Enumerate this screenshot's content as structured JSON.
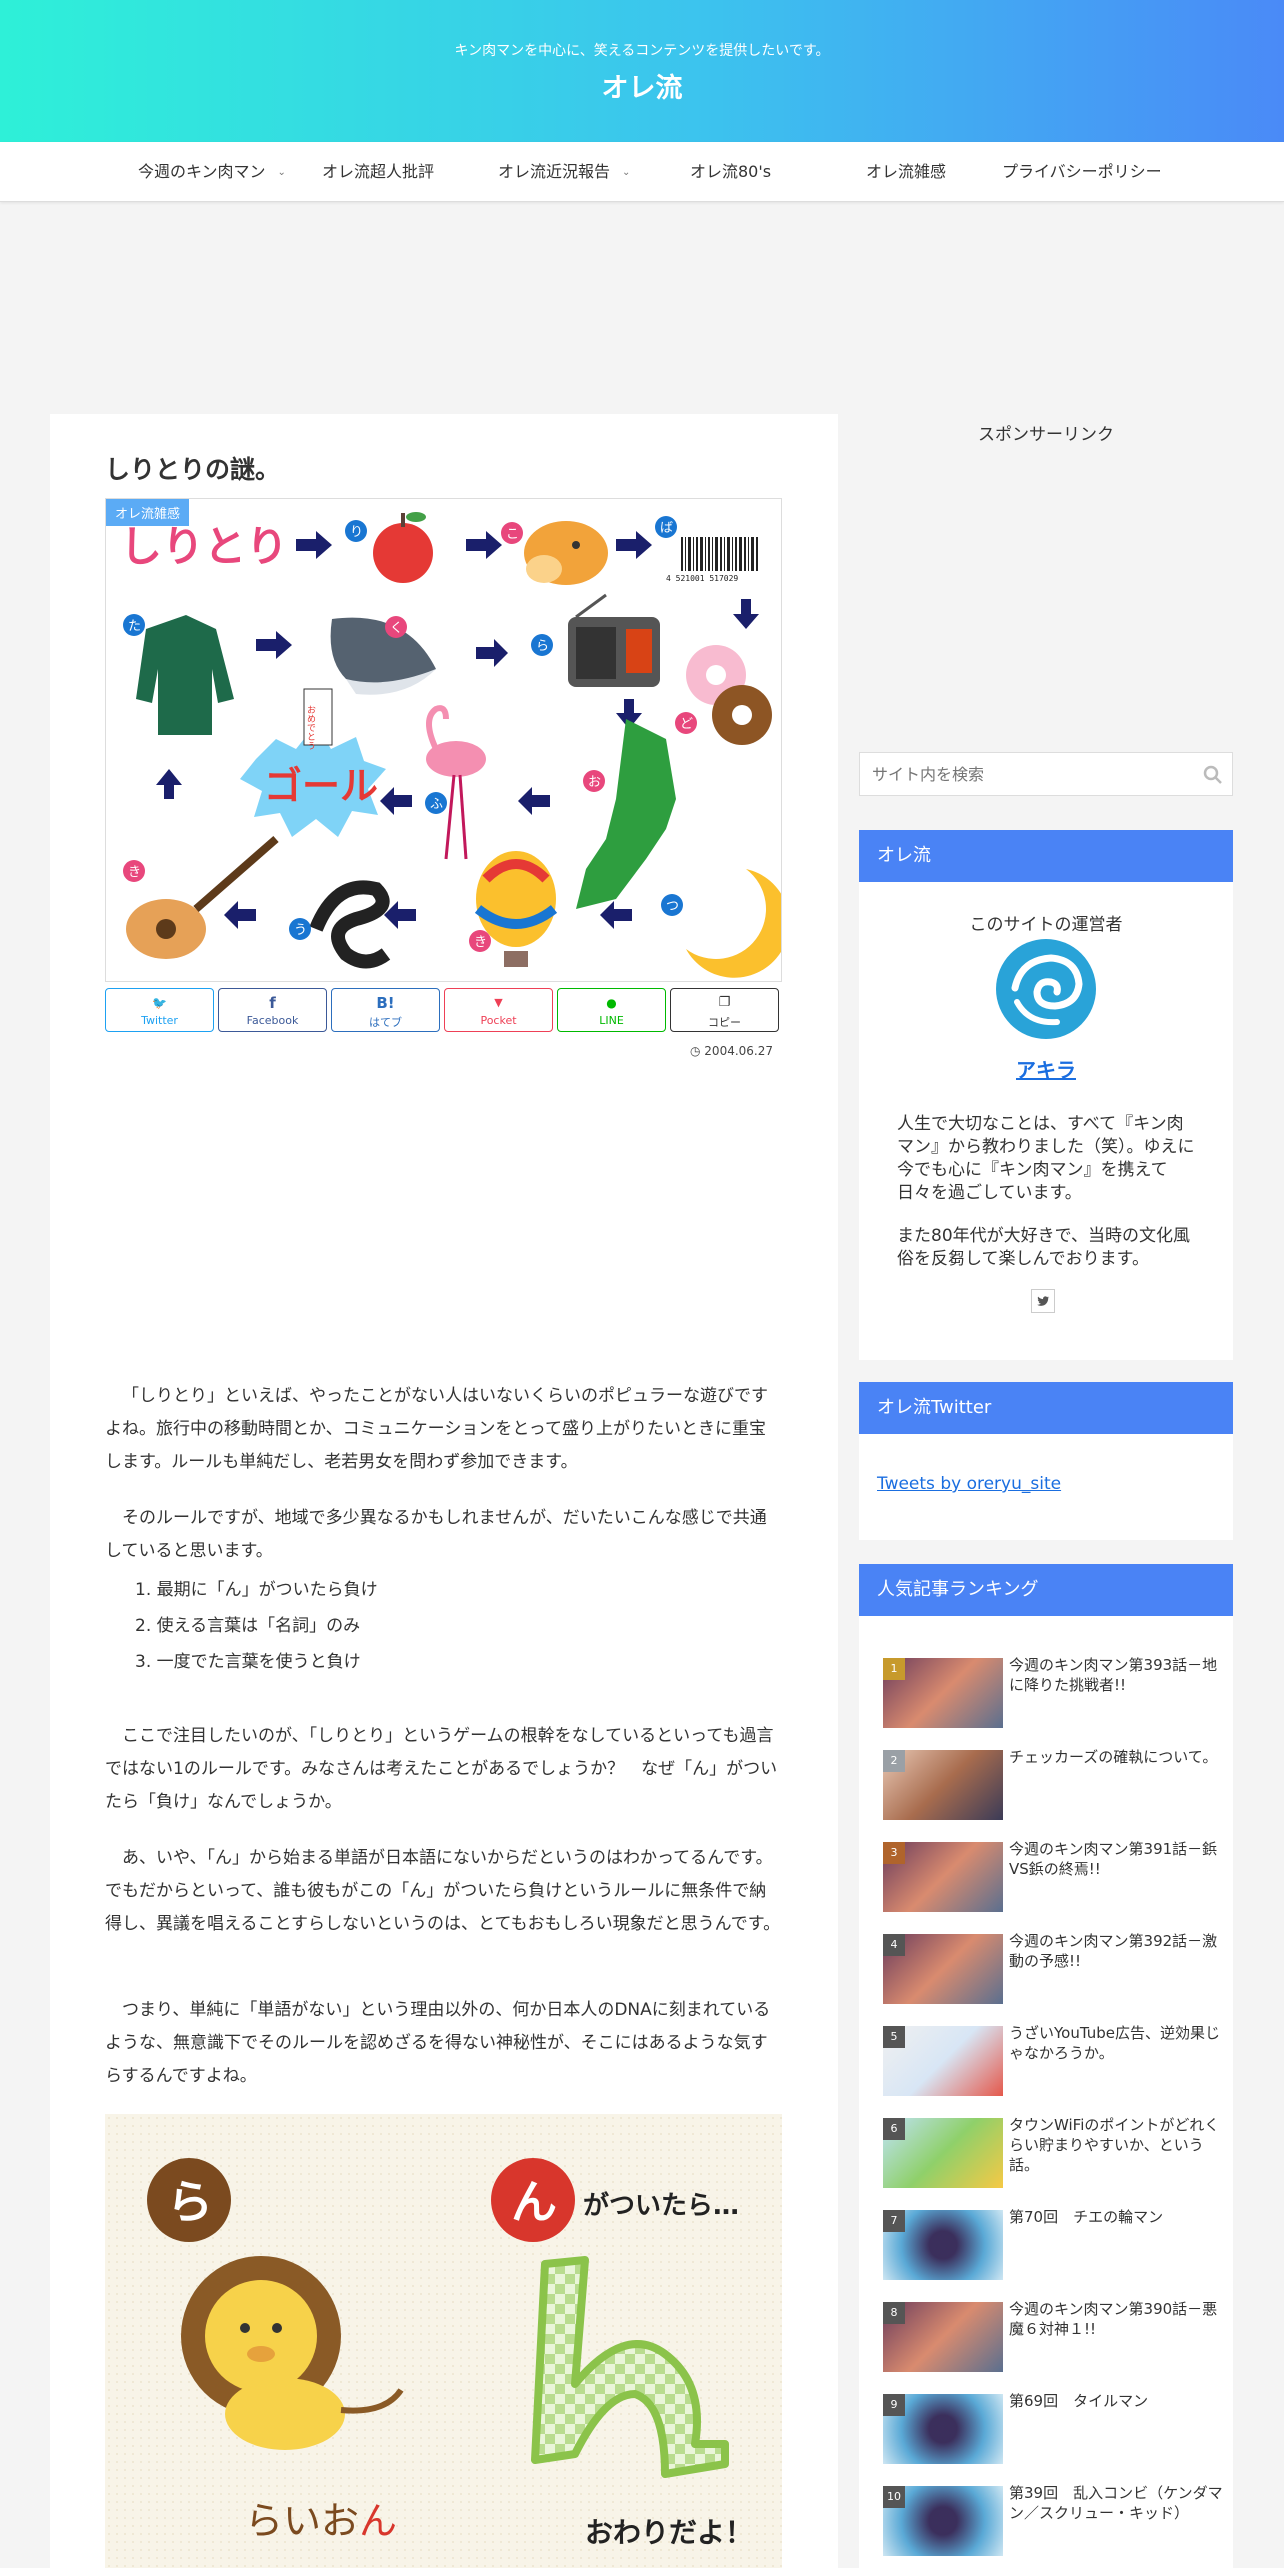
{
  "header": {
    "tagline": "キン肉マンを中心に、笑えるコンテンツを提供したいです。",
    "site_title": "オレ流"
  },
  "nav": {
    "items": [
      {
        "label": "今週のキン肉マン"
      },
      {
        "label": "オレ流超人批評"
      },
      {
        "label": "オレ流近況報告"
      },
      {
        "label": "オレ流80's"
      },
      {
        "label": "オレ流雑感"
      },
      {
        "label": "プライバシーポリシー"
      }
    ]
  },
  "article": {
    "title": "しりとりの謎。",
    "category": "オレ流雑感",
    "eyecatch_text": {
      "shiritori": "しりとり",
      "goal": "ゴール",
      "omedetou": "おめでとう",
      "barcode": "4 521001 517029"
    },
    "share": [
      {
        "icon": "🐦",
        "label": "Twitter"
      },
      {
        "icon": "f",
        "label": "Facebook"
      },
      {
        "icon": "B!",
        "label": "はてブ"
      },
      {
        "icon": "▼",
        "label": "Pocket"
      },
      {
        "icon": "●",
        "label": "LINE"
      },
      {
        "icon": "❐",
        "label": "コピー"
      }
    ],
    "date": "2004.06.27",
    "p1": "「しりとり」といえば、やったことがない人はいないくらいのポピュラーな遊びですよね。旅行中の移動時間とか、コミュニケーションをとって盛り上がりたいときに重宝します。ルールも単純だし、老若男女を問わず参加できます。",
    "p2": "そのルールですが、地域で多少異なるかもしれませんが、だいたいこんな感じで共通していると思います。",
    "rules": [
      "最期に「ん」がついたら負け",
      "使える言葉は「名詞」のみ",
      "一度でた言葉を使うと負け"
    ],
    "p3": "ここで注目したいのが、「しりとり」というゲームの根幹をなしているといっても過言ではない1のルールです。みなさんは考えたことがあるでしょうか？　なぜ「ん」がついたら「負け」なんでしょうか。",
    "p4": "あ、いや、「ん」から始まる単語が日本語にないからだというのはわかってるんです。でもだからといって、誰も彼もがこの「ん」がついたら負けというルールに無条件で納得し、異議を唱えることすらしないというのは、とてもおもしろい現象だと思うんです。",
    "p5": "つまり、単純に「単語がない」という理由以外の、何か日本人のDNAに刻まれているような、無意識下でそのルールを認めざるを得ない神秘性が、そこにはあるような気すらするんですよね。",
    "illus2": {
      "ra": "ら",
      "n": "ん",
      "ga_tsuitara": "がついたら…",
      "raion_a": "らいお",
      "raion_b": "ん",
      "owari": "おわりだよ！"
    }
  },
  "sidebar": {
    "sponsor_label": "スポンサーリンク",
    "search_placeholder": "サイト内を検索",
    "profile": {
      "heading": "オレ流",
      "caption": "このサイトの運営者",
      "name": "アキラ",
      "desc1": "人生で大切なことは、すべて『キン肉マン』から教わりました（笑）。ゆえに今でも心に『キン肉マン』を携えて日々を過ごしています。",
      "desc2": "また80年代が大好きで、当時の文化風俗を反芻して楽しんでおります。"
    },
    "twitter": {
      "heading": "オレ流Twitter",
      "link": "Tweets by oreryu_site"
    },
    "ranking": {
      "heading": "人気記事ランキング",
      "items": [
        {
          "num": "1",
          "title": "今週のキン肉マン第393話－地に降りた挑戦者!!"
        },
        {
          "num": "2",
          "title": "チェッカーズの確執について。"
        },
        {
          "num": "3",
          "title": "今週のキン肉マン第391話－鋲VS鋲の終焉!!"
        },
        {
          "num": "4",
          "title": "今週のキン肉マン第392話－激動の予感!!"
        },
        {
          "num": "5",
          "title": "うざいYouTube広告、逆効果じゃなかろうか。"
        },
        {
          "num": "6",
          "title": "タウンWiFiのポイントがどれくらい貯まりやすいか、という話。"
        },
        {
          "num": "7",
          "title": "第70回　チエの輪マン"
        },
        {
          "num": "8",
          "title": "今週のキン肉マン第390話－悪魔６対神１!!"
        },
        {
          "num": "9",
          "title": "第69回　タイルマン"
        },
        {
          "num": "10",
          "title": "第39回　乱入コンビ（ケンダマン／スクリュー・キッド）"
        }
      ]
    }
  },
  "colors": {
    "header_gradient_start": "#2ef0d8",
    "header_gradient_end": "#4a8af7",
    "widget_head": "#4a83f5",
    "link": "#1a6ee0",
    "category_label": "#4ea4f5"
  }
}
